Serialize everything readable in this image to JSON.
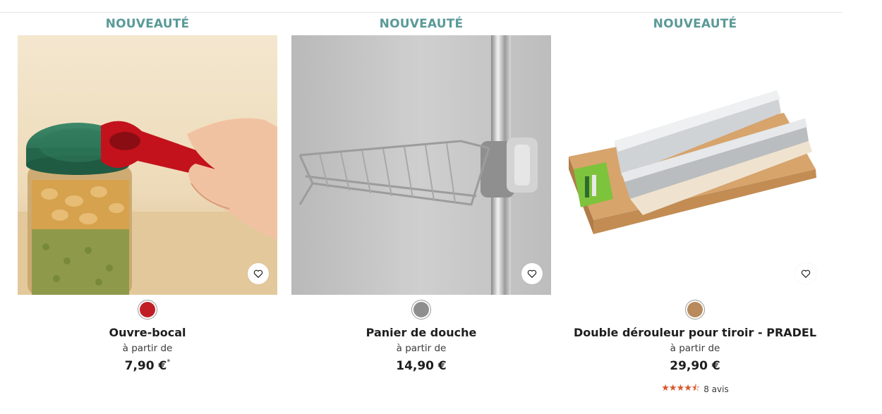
{
  "products": [
    {
      "badge": "NOUVEAUTÉ",
      "name": "Ouvre-bocal",
      "price_prefix": "à partir de",
      "price": "7,90 €",
      "price_note": "*",
      "swatch_color": "#c01e24",
      "image_icon": "jar-opener-photo"
    },
    {
      "badge": "NOUVEAUTÉ",
      "name": "Panier de douche",
      "price_prefix": "à partir de",
      "price": "14,90 €",
      "swatch_color": "#8e8e8e",
      "image_icon": "shower-basket-photo"
    },
    {
      "badge": "NOUVEAUTÉ",
      "name": "Double dérouleur pour tiroir - PRADEL",
      "price_prefix": "à partir de",
      "price": "29,90 €",
      "swatch_color": "#b98a5c",
      "image_icon": "foil-dispenser-photo",
      "rating": {
        "stars": 4.5,
        "reviews": "8 avis"
      }
    }
  ],
  "icons": {
    "favorite": "heart-outline-icon"
  }
}
